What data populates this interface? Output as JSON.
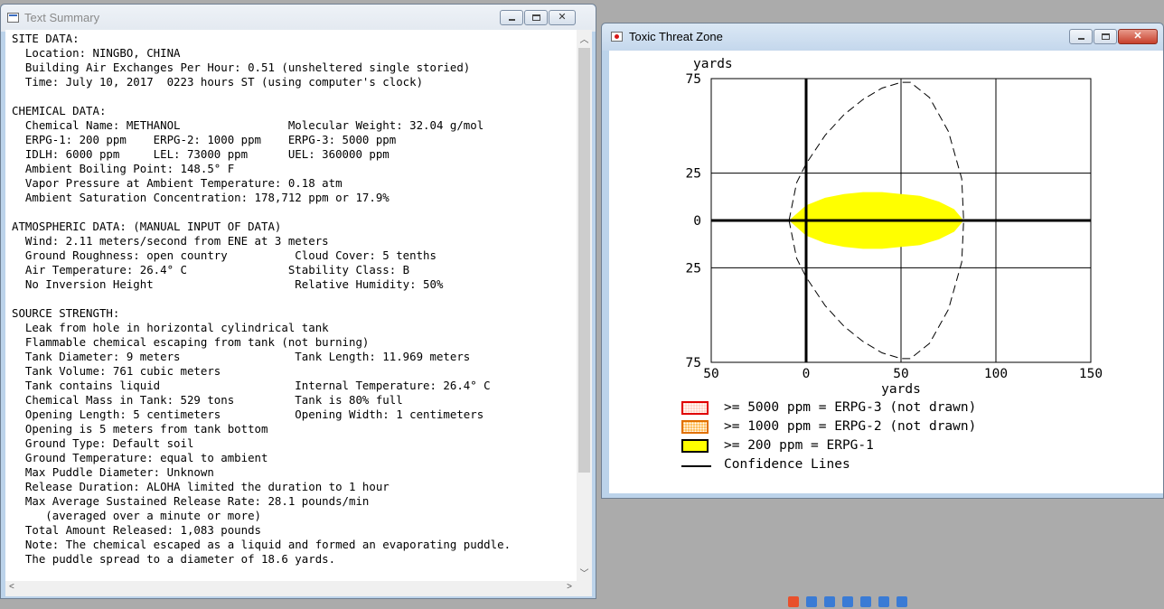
{
  "text_window": {
    "title": "Text Summary",
    "lines": [
      "SITE DATA:",
      "  Location: NINGBO, CHINA",
      "  Building Air Exchanges Per Hour: 0.51 (unsheltered single storied)",
      "  Time: July 10, 2017  0223 hours ST (using computer's clock)",
      "",
      "CHEMICAL DATA:",
      "  Chemical Name: METHANOL                Molecular Weight: 32.04 g/mol",
      "  ERPG-1: 200 ppm    ERPG-2: 1000 ppm    ERPG-3: 5000 ppm",
      "  IDLH: 6000 ppm     LEL: 73000 ppm      UEL: 360000 ppm",
      "  Ambient Boiling Point: 148.5° F",
      "  Vapor Pressure at Ambient Temperature: 0.18 atm",
      "  Ambient Saturation Concentration: 178,712 ppm or 17.9%",
      "",
      "ATMOSPHERIC DATA: (MANUAL INPUT OF DATA)",
      "  Wind: 2.11 meters/second from ENE at 3 meters",
      "  Ground Roughness: open country          Cloud Cover: 5 tenths",
      "  Air Temperature: 26.4° C               Stability Class: B",
      "  No Inversion Height                     Relative Humidity: 50%",
      "",
      "SOURCE STRENGTH:",
      "  Leak from hole in horizontal cylindrical tank",
      "  Flammable chemical escaping from tank (not burning)",
      "  Tank Diameter: 9 meters                 Tank Length: 11.969 meters",
      "  Tank Volume: 761 cubic meters",
      "  Tank contains liquid                    Internal Temperature: 26.4° C",
      "  Chemical Mass in Tank: 529 tons         Tank is 80% full",
      "  Opening Length: 5 centimeters           Opening Width: 1 centimeters",
      "  Opening is 5 meters from tank bottom",
      "  Ground Type: Default soil",
      "  Ground Temperature: equal to ambient",
      "  Max Puddle Diameter: Unknown",
      "  Release Duration: ALOHA limited the duration to 1 hour",
      "  Max Average Sustained Release Rate: 28.1 pounds/min",
      "     (averaged over a minute or more)",
      "  Total Amount Released: 1,083 pounds",
      "  Note: The chemical escaped as a liquid and formed an evaporating puddle.",
      "  The puddle spread to a diameter of 18.6 yards."
    ]
  },
  "plot_window": {
    "title": "Toxic Threat Zone",
    "legend": [
      {
        "label": ">= 5000 ppm = ERPG-3 (not drawn)",
        "border": "#e00000",
        "fill": "#ffd6c8"
      },
      {
        "label": ">= 1000 ppm = ERPG-2 (not drawn)",
        "border": "#e07000",
        "fill": "#ffc060"
      },
      {
        "label": ">= 200 ppm = ERPG-1",
        "border": "#000000",
        "fill": "#ffff00"
      },
      {
        "label": "Confidence Lines",
        "border": "#000000",
        "fill": "none"
      }
    ]
  },
  "chart_data": {
    "type": "area",
    "xlabel": "yards",
    "ylabel": "yards",
    "xlim": [
      -50,
      150
    ],
    "ylim": [
      -75,
      75
    ],
    "x_ticks": [
      -50,
      0,
      50,
      100,
      150
    ],
    "x_tick_labels": [
      "50",
      "0",
      "50",
      "100",
      "150"
    ],
    "y_ticks": [
      75,
      25,
      0,
      -25,
      -75
    ],
    "y_tick_labels": [
      "75",
      "25",
      "0",
      "25",
      "75"
    ],
    "grid": true,
    "series": [
      {
        "name": ">= 200 ppm = ERPG-1",
        "kind": "filled",
        "color": "#ffff00",
        "x": [
          -9,
          0,
          10,
          20,
          30,
          40,
          50,
          60,
          70,
          78,
          83,
          78,
          70,
          60,
          50,
          40,
          30,
          20,
          10,
          0,
          -9
        ],
        "y": [
          0,
          8,
          12,
          14,
          15,
          15,
          14,
          13,
          10,
          6,
          0,
          -6,
          -10,
          -13,
          -14,
          -15,
          -15,
          -14,
          -12,
          -8,
          0
        ]
      },
      {
        "name": "Confidence Lines",
        "kind": "dashed",
        "color": "#000000",
        "x": [
          -9,
          -5,
          0,
          10,
          20,
          30,
          40,
          50,
          55,
          65,
          75,
          82,
          83,
          82,
          75,
          65,
          55,
          50,
          40,
          30,
          20,
          10,
          0,
          -5,
          -9
        ],
        "y": [
          0,
          20,
          30,
          45,
          56,
          64,
          70,
          73,
          73,
          65,
          47,
          22,
          0,
          -22,
          -47,
          -65,
          -73,
          -73,
          -70,
          -64,
          -56,
          -45,
          -30,
          -20,
          0
        ]
      }
    ]
  }
}
